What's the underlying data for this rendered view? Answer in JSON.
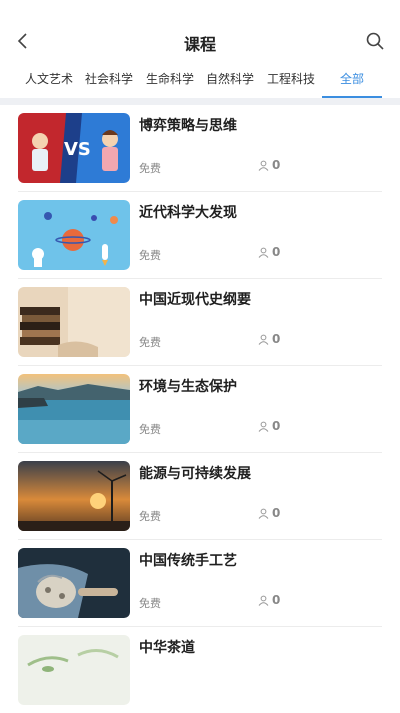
{
  "header": {
    "title": "课程",
    "back_icon": "chevron-left-icon",
    "search_icon": "search-icon"
  },
  "tabs": [
    {
      "label": "人文艺术",
      "active": false
    },
    {
      "label": "社会科学",
      "active": false
    },
    {
      "label": "生命科学",
      "active": false
    },
    {
      "label": "自然科学",
      "active": false
    },
    {
      "label": "工程科技",
      "active": false
    },
    {
      "label": "全部",
      "active": true
    }
  ],
  "colors": {
    "accent": "#3b8ee0",
    "separator": "#eef0f4"
  },
  "courses": [
    {
      "title": "博弈策略与思维",
      "price": "免费",
      "learners": "0",
      "thumb": "versus-illustration"
    },
    {
      "title": "近代科学大发现",
      "price": "免费",
      "learners": "0",
      "thumb": "space-illustration"
    },
    {
      "title": "中国近现代史纲要",
      "price": "免费",
      "learners": "0",
      "thumb": "books-photo"
    },
    {
      "title": "环境与生态保护",
      "price": "免费",
      "learners": "0",
      "thumb": "lake-photo"
    },
    {
      "title": "能源与可持续发展",
      "price": "免费",
      "learners": "0",
      "thumb": "wind-turbine-photo"
    },
    {
      "title": "中国传统手工艺",
      "price": "免费",
      "learners": "0",
      "thumb": "craft-photo"
    },
    {
      "title": "中华茶道",
      "price": "",
      "learners": "",
      "thumb": "tea-photo"
    }
  ]
}
